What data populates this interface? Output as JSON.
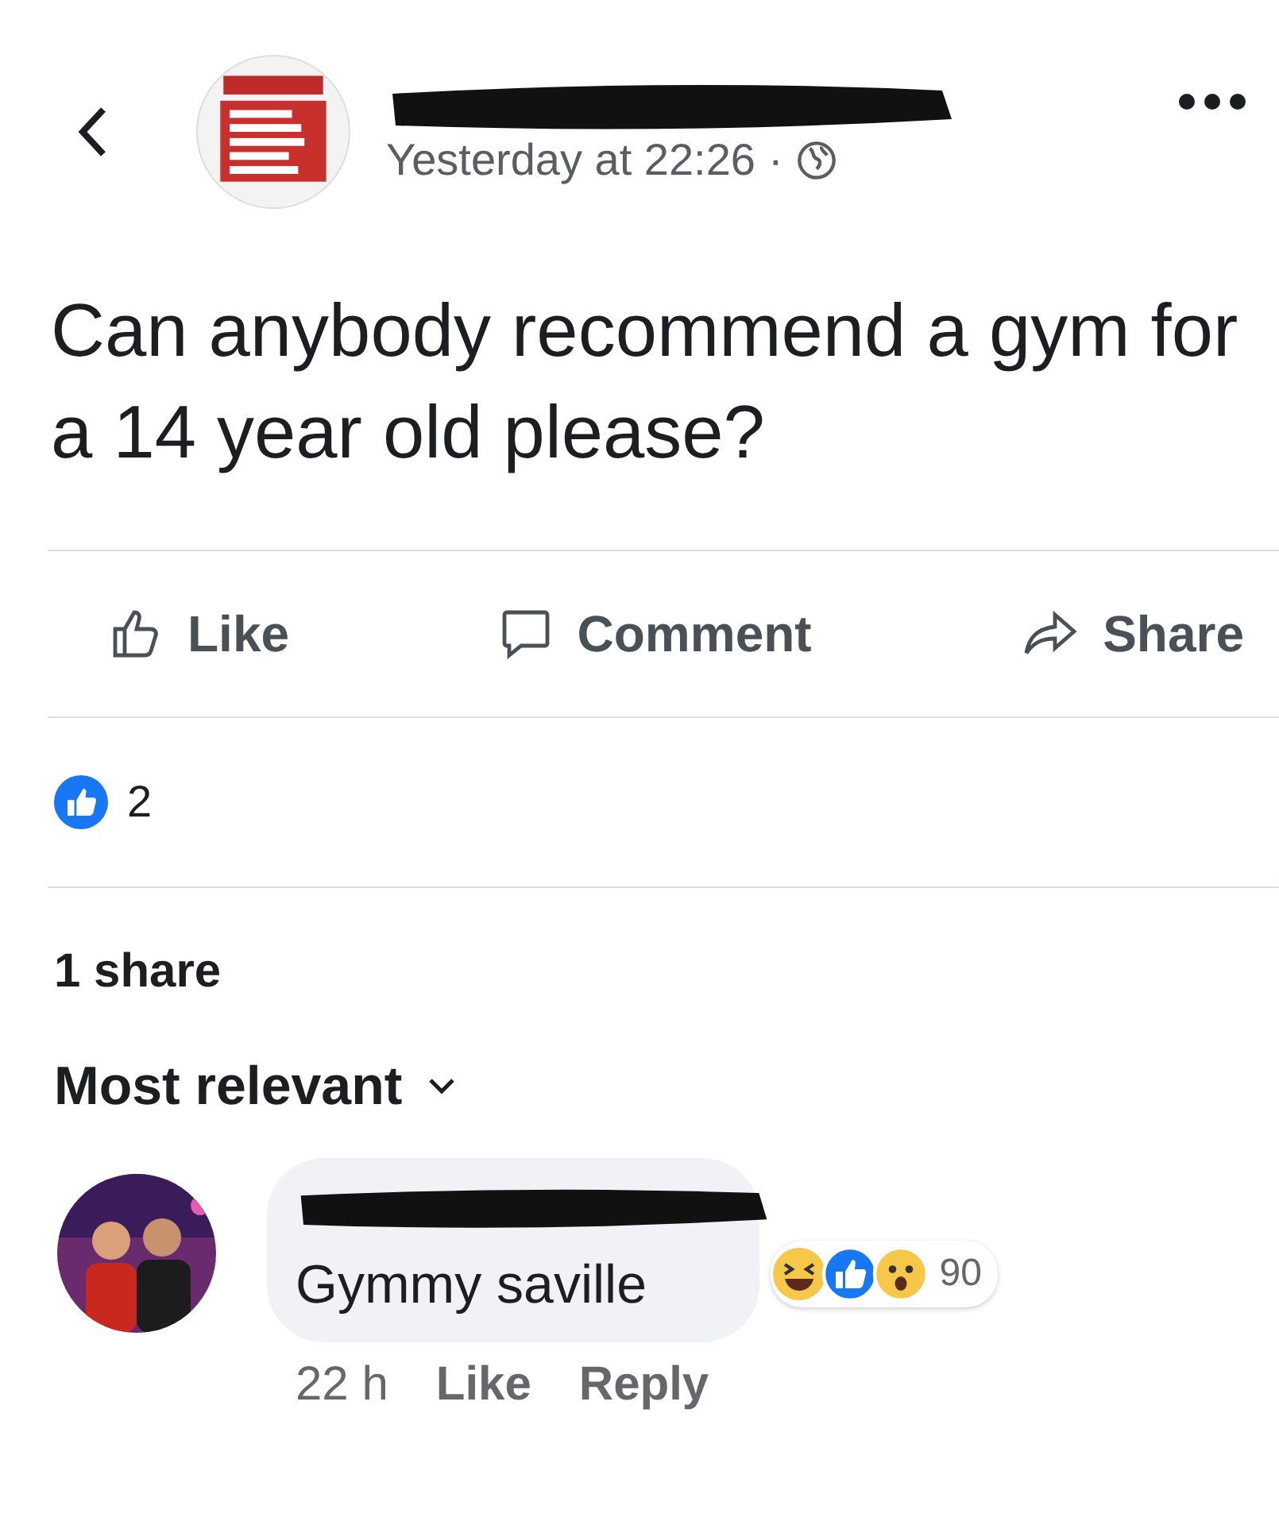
{
  "header": {
    "time": "Yesterday at 22:26",
    "separator": "·"
  },
  "post": {
    "text": "Can anybody recommend a gym for a 14 year old please?"
  },
  "actions": [
    {
      "label": "Like",
      "kind": "like"
    },
    {
      "label": "Comment",
      "kind": "comment"
    },
    {
      "label": "Share",
      "kind": "share"
    }
  ],
  "reactions": {
    "count": "2"
  },
  "shares": "1 share",
  "sort": {
    "label": "Most relevant"
  },
  "comment": {
    "text": "Gymmy saville",
    "reaction_count": "90",
    "time": "22 h",
    "actions": [
      "Like",
      "Reply"
    ]
  }
}
